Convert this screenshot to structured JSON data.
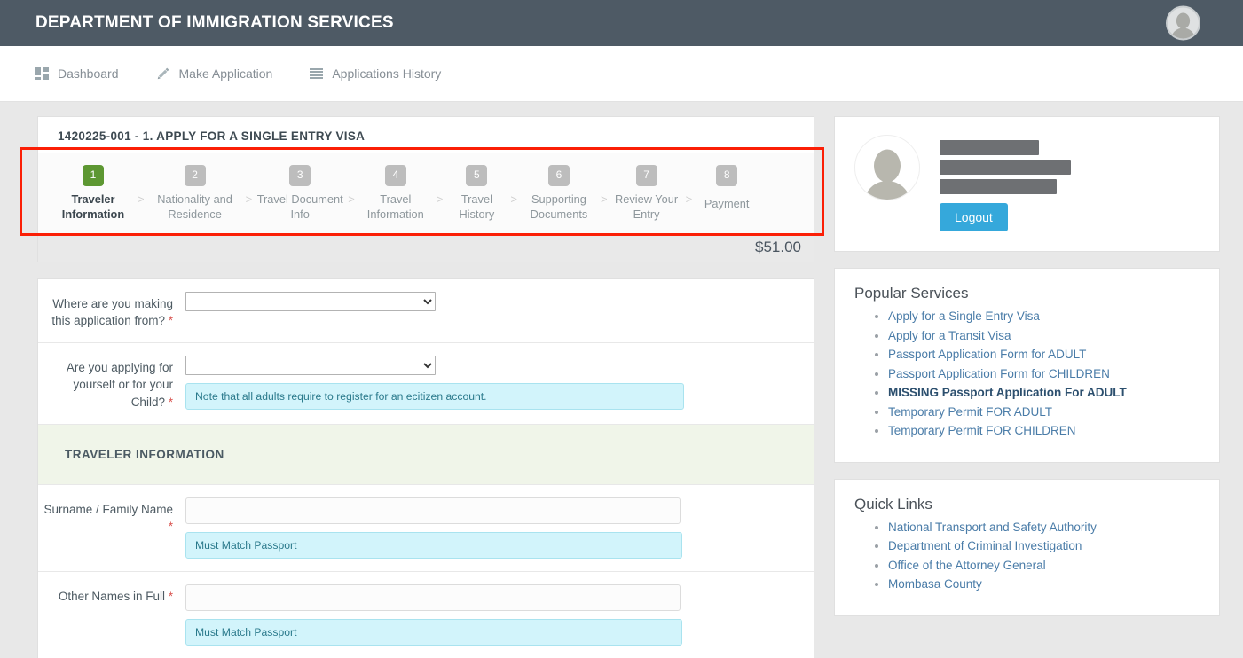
{
  "header": {
    "title": "DEPARTMENT OF IMMIGRATION SERVICES",
    "avatar_icon": "user-avatar-icon"
  },
  "nav": {
    "items": [
      {
        "label": "Dashboard",
        "icon": "grid-icon"
      },
      {
        "label": "Make Application",
        "icon": "pencil-icon"
      },
      {
        "label": "Applications History",
        "icon": "list-icon"
      }
    ]
  },
  "application": {
    "card_title": "1420225-001 - 1. APPLY FOR A SINGLE ENTRY VISA",
    "price": "$51.00",
    "separator": ">",
    "steps": [
      {
        "number": "1",
        "label": "Traveler Information",
        "active": true
      },
      {
        "number": "2",
        "label": "Nationality and Residence",
        "active": false
      },
      {
        "number": "3",
        "label": "Travel Document Info",
        "active": false
      },
      {
        "number": "4",
        "label": "Travel Information",
        "active": false
      },
      {
        "number": "5",
        "label": "Travel History",
        "active": false
      },
      {
        "number": "6",
        "label": "Supporting Documents",
        "active": false
      },
      {
        "number": "7",
        "label": "Review Your Entry",
        "active": false
      },
      {
        "number": "8",
        "label": "Payment",
        "active": false
      }
    ],
    "highlight_color": "#fb1f06"
  },
  "form": {
    "section_title": "TRAVELER INFORMATION",
    "required_marker": "*",
    "fields": {
      "application_from": {
        "label": "Where are you making this application from?",
        "value": "",
        "type": "select"
      },
      "applying_for": {
        "label": "Are you applying for yourself or for your Child?",
        "value": "",
        "type": "select",
        "hint": "Note that all adults require to register for an ecitizen account."
      },
      "surname": {
        "label": "Surname / Family Name",
        "value": "",
        "placeholder": "",
        "hint": "Must Match Passport"
      },
      "other_names": {
        "label": "Other Names in Full",
        "value": "",
        "placeholder": "",
        "hint": "Must Match Passport"
      }
    }
  },
  "sidebar": {
    "profile": {
      "avatar_icon": "user-avatar-icon",
      "name_redacted": true,
      "logout_label": "Logout"
    },
    "popular_services": {
      "title": "Popular Services",
      "links": [
        {
          "label": "Apply for a Single Entry Visa",
          "bold": false
        },
        {
          "label": "Apply for a Transit Visa",
          "bold": false
        },
        {
          "label": "Passport Application Form for ADULT",
          "bold": false
        },
        {
          "label": "Passport Application Form for CHILDREN",
          "bold": false
        },
        {
          "label": "MISSING Passport Application For ADULT",
          "bold": true
        },
        {
          "label": "Temporary Permit FOR ADULT",
          "bold": false
        },
        {
          "label": "Temporary Permit FOR CHILDREN",
          "bold": false
        }
      ]
    },
    "quick_links": {
      "title": "Quick Links",
      "links": [
        {
          "label": "National Transport and Safety Authority",
          "bold": false
        },
        {
          "label": "Department of Criminal Investigation",
          "bold": false
        },
        {
          "label": "Office of the Attorney General",
          "bold": false
        },
        {
          "label": "Mombasa County",
          "bold": false
        }
      ]
    }
  },
  "colors": {
    "header_bg": "#4e5a65",
    "active_step": "#5d9732",
    "logout_button": "#35a8db",
    "hint_bg": "#d2f4fb",
    "link": "#4a7ca8"
  }
}
